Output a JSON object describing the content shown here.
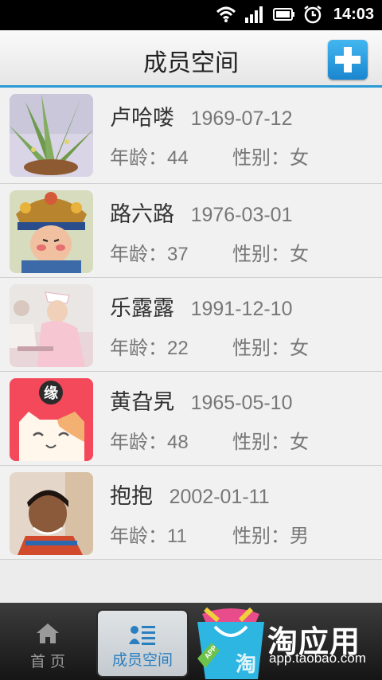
{
  "status_bar": {
    "time": "14:03"
  },
  "header": {
    "title": "成员空间"
  },
  "members": [
    {
      "name": "卢哈喽",
      "birth": "1969-07-12",
      "age_label": "年龄：",
      "age": "44",
      "gender_label": "性别：",
      "gender": "女"
    },
    {
      "name": "路六路",
      "birth": "1976-03-01",
      "age_label": "年龄：",
      "age": "37",
      "gender_label": "性别：",
      "gender": "女"
    },
    {
      "name": "乐露露",
      "birth": "1991-12-10",
      "age_label": "年龄：",
      "age": "22",
      "gender_label": "性别：",
      "gender": "女"
    },
    {
      "name": "黄旮旯",
      "birth": "1965-05-10",
      "age_label": "年龄：",
      "age": "48",
      "gender_label": "性别：",
      "gender": "女"
    },
    {
      "name": "抱抱",
      "birth": "2002-01-11",
      "age_label": "年龄：",
      "age": "11",
      "gender_label": "性别：",
      "gender": "男"
    }
  ],
  "avatar_badge": "缘",
  "tabs": [
    {
      "label": "首 页"
    },
    {
      "label": "成员空间"
    }
  ],
  "promo": {
    "title": "淘应用",
    "url": "app.taobao.com",
    "bag_text": "淘",
    "tag_text": "APP"
  }
}
